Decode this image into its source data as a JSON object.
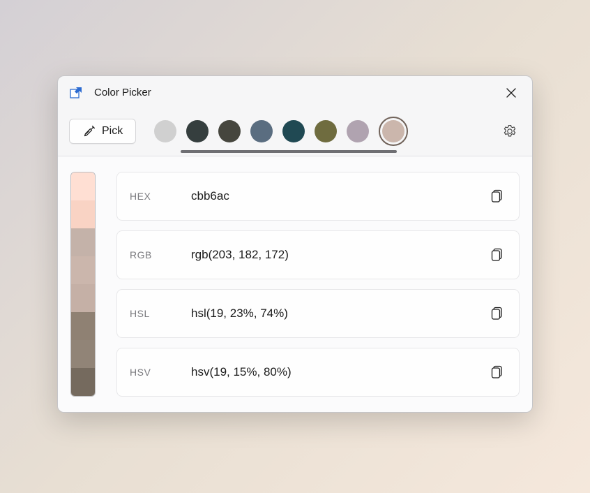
{
  "window": {
    "title": "Color Picker"
  },
  "toolbar": {
    "pick_label": "Pick",
    "swatches": [
      {
        "color": "#d0d0d0"
      },
      {
        "color": "#353e3e"
      },
      {
        "color": "#46463e"
      },
      {
        "color": "#5a6d80"
      },
      {
        "color": "#204953"
      },
      {
        "color": "#6f6c3f"
      },
      {
        "color": "#b0a3b0"
      }
    ],
    "selected_swatch": {
      "color": "#cbb6ac",
      "ring": "#6e6057"
    }
  },
  "shades": [
    "#ffdfd3",
    "#f9d3c4",
    "#c4b2a9",
    "#cbb6ac",
    "#c5b0a6",
    "#8f8173",
    "#918477",
    "#756a5e"
  ],
  "formats": [
    {
      "label": "HEX",
      "value": "cbb6ac"
    },
    {
      "label": "RGB",
      "value": "rgb(203, 182, 172)"
    },
    {
      "label": "HSL",
      "value": "hsl(19, 23%, 74%)"
    },
    {
      "label": "HSV",
      "value": "hsv(19, 15%, 80%)"
    }
  ]
}
